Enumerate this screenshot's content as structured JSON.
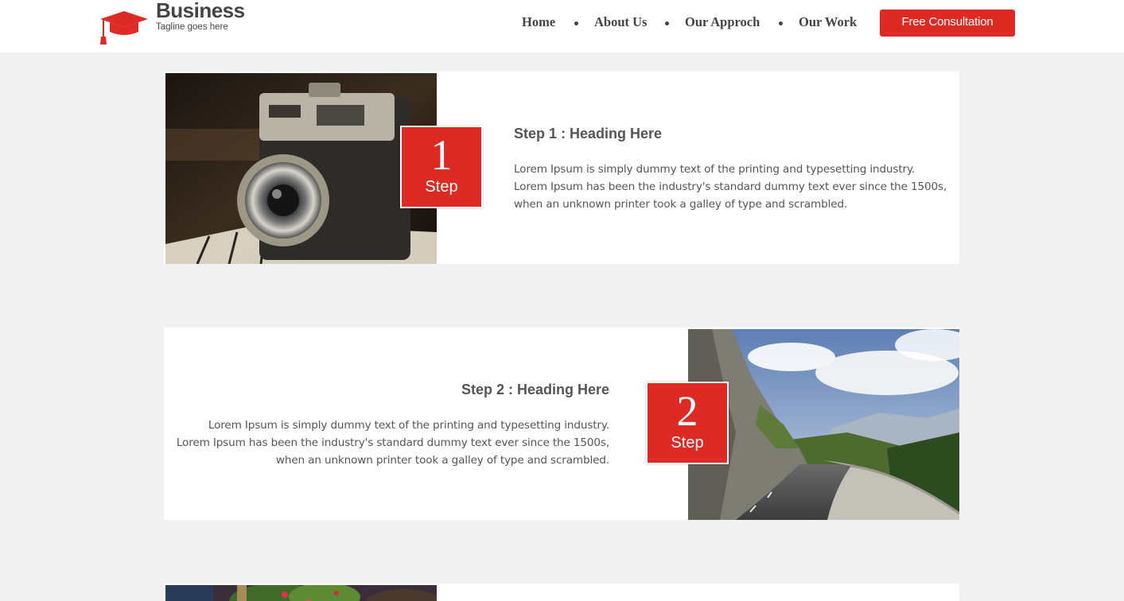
{
  "header": {
    "brand": "Business",
    "tagline": "Tagline goes here",
    "logo_icon": "graduation-cap-icon",
    "nav": [
      "Home",
      "About Us",
      "Our Approch",
      "Our Work"
    ],
    "cta": "Free Consultation"
  },
  "steps": [
    {
      "number": "1",
      "label": "Step",
      "title": "Step 1 : Heading Here",
      "text": "Lorem Ipsum is simply dummy text of the printing and typesetting industry. Lorem Ipsum has been the industry's standard dummy text ever since the 1500s, when an unknown printer took a galley of type and scrambled."
    },
    {
      "number": "2",
      "label": "Step",
      "title": "Step 2 : Heading Here",
      "text": "Lorem Ipsum is simply dummy text of the printing and typesetting industry. Lorem Ipsum has been the industry's standard dummy text ever since the 1500s, when an unknown printer took a galley of type and scrambled."
    }
  ],
  "colors": {
    "accent": "#de2a25",
    "background": "#f1f1f1",
    "card": "#ffffff",
    "text": "#555555"
  }
}
